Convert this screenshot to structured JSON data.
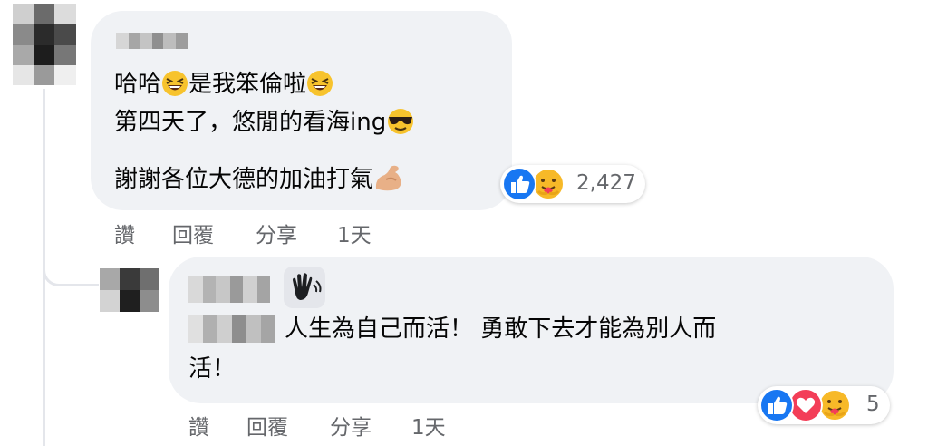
{
  "comment": {
    "lines": [
      "哈哈",
      "是我笨倫啦",
      "第四天了，悠閒的看海ing",
      "謝謝各位大德的加油打氣"
    ],
    "actions": {
      "like": "讚",
      "reply": "回覆",
      "share": "分享",
      "time": "1天"
    },
    "reactions": {
      "icons": [
        "like-icon",
        "care-icon"
      ],
      "count": "2,427"
    }
  },
  "reply": {
    "name_badge_icon": "wave-hand-icon",
    "line1": "人生為自己而活！ 勇敢下去才能為別人而",
    "line2": "活！",
    "actions": {
      "like": "讚",
      "reply": "回覆",
      "share": "分享",
      "time": "1天"
    },
    "reactions": {
      "icons": [
        "like-icon",
        "love-icon",
        "care-icon"
      ],
      "count": "5"
    }
  },
  "colors": {
    "bubble": "#f0f2f5",
    "secondary_text": "#65676b",
    "like_blue": "#1877f2",
    "love_red": "#f33e58",
    "care_yellow": "#f7b928"
  }
}
